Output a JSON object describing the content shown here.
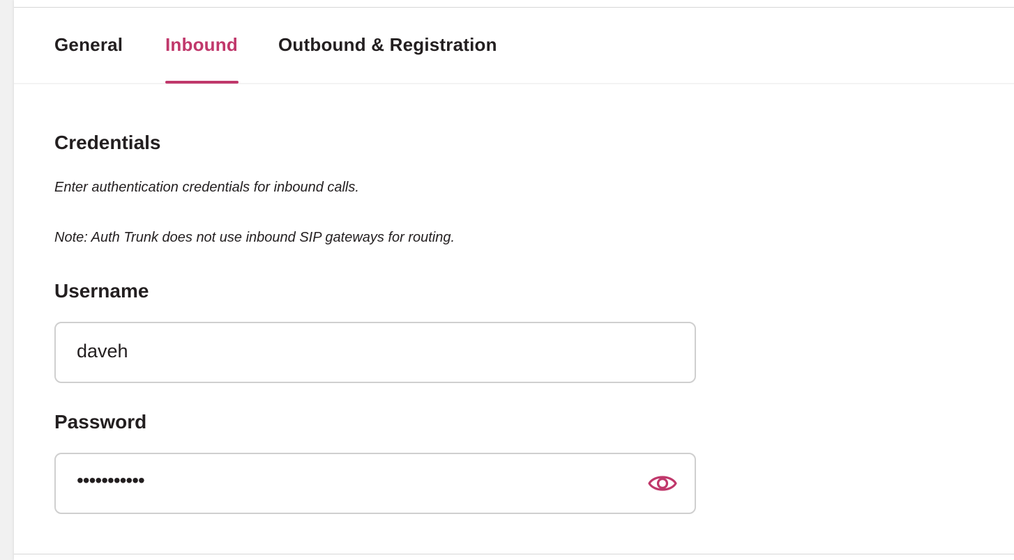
{
  "tabs": [
    {
      "label": "General",
      "active": false
    },
    {
      "label": "Inbound",
      "active": true
    },
    {
      "label": "Outbound & Registration",
      "active": false
    }
  ],
  "section": {
    "title": "Credentials",
    "description": "Enter authentication credentials for inbound calls.",
    "note": "Note: Auth Trunk does not use inbound SIP gateways for routing."
  },
  "fields": {
    "username": {
      "label": "Username",
      "value": "daveh"
    },
    "password": {
      "label": "Password",
      "value": "•••••••••••",
      "toggle_icon": "eye-icon"
    }
  },
  "colors": {
    "accent": "#c0386b",
    "text": "#231f20",
    "border": "#cfcfcf"
  }
}
